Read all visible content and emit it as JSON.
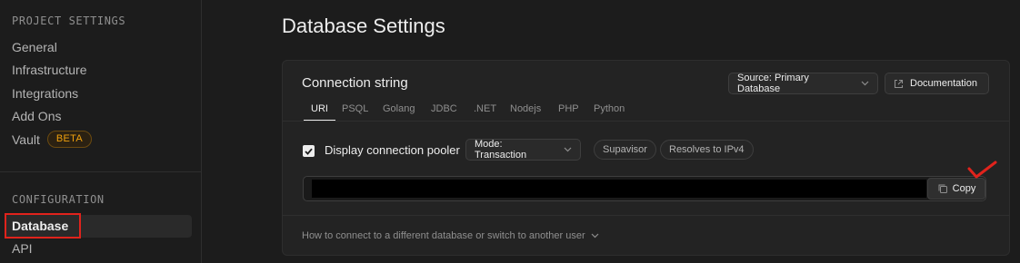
{
  "sidebar": {
    "project_settings_title": "PROJECT SETTINGS",
    "project_items": [
      {
        "label": "General"
      },
      {
        "label": "Infrastructure"
      },
      {
        "label": "Integrations"
      },
      {
        "label": "Add Ons"
      },
      {
        "label": "Vault",
        "badge": "BETA"
      }
    ],
    "configuration_title": "CONFIGURATION",
    "config_items": [
      {
        "label": "Database"
      },
      {
        "label": "API"
      }
    ]
  },
  "main": {
    "title": "Database Settings",
    "connection": {
      "title": "Connection string",
      "source_label": "Source: Primary Database",
      "docs_label": "Documentation",
      "tabs": [
        "URI",
        "PSQL",
        "Golang",
        "JDBC",
        ".NET",
        "Nodejs",
        "PHP",
        "Python"
      ],
      "active_tab": "URI",
      "pooler_label": "Display connection pooler",
      "pooler_checked": true,
      "mode_label": "Mode: Transaction",
      "pills": [
        "Supavisor",
        "Resolves to IPv4"
      ],
      "copy_label": "Copy",
      "help_text": "How to connect to a different database or switch to another user"
    }
  },
  "colors": {
    "background": "#1c1c1c",
    "panel": "#232323",
    "beta_accent": "#f1a10d",
    "annotation_red": "#e0231c"
  }
}
